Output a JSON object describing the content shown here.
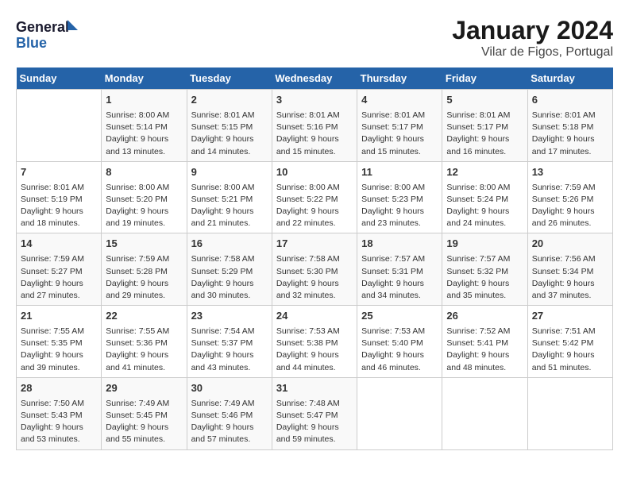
{
  "header": {
    "logo_line1": "General",
    "logo_line2": "Blue",
    "title": "January 2024",
    "subtitle": "Vilar de Figos, Portugal"
  },
  "days_of_week": [
    "Sunday",
    "Monday",
    "Tuesday",
    "Wednesday",
    "Thursday",
    "Friday",
    "Saturday"
  ],
  "weeks": [
    [
      {
        "day": "",
        "info": ""
      },
      {
        "day": "1",
        "info": "Sunrise: 8:00 AM\nSunset: 5:14 PM\nDaylight: 9 hours\nand 13 minutes."
      },
      {
        "day": "2",
        "info": "Sunrise: 8:01 AM\nSunset: 5:15 PM\nDaylight: 9 hours\nand 14 minutes."
      },
      {
        "day": "3",
        "info": "Sunrise: 8:01 AM\nSunset: 5:16 PM\nDaylight: 9 hours\nand 15 minutes."
      },
      {
        "day": "4",
        "info": "Sunrise: 8:01 AM\nSunset: 5:17 PM\nDaylight: 9 hours\nand 15 minutes."
      },
      {
        "day": "5",
        "info": "Sunrise: 8:01 AM\nSunset: 5:17 PM\nDaylight: 9 hours\nand 16 minutes."
      },
      {
        "day": "6",
        "info": "Sunrise: 8:01 AM\nSunset: 5:18 PM\nDaylight: 9 hours\nand 17 minutes."
      }
    ],
    [
      {
        "day": "7",
        "info": "Sunrise: 8:01 AM\nSunset: 5:19 PM\nDaylight: 9 hours\nand 18 minutes."
      },
      {
        "day": "8",
        "info": "Sunrise: 8:00 AM\nSunset: 5:20 PM\nDaylight: 9 hours\nand 19 minutes."
      },
      {
        "day": "9",
        "info": "Sunrise: 8:00 AM\nSunset: 5:21 PM\nDaylight: 9 hours\nand 21 minutes."
      },
      {
        "day": "10",
        "info": "Sunrise: 8:00 AM\nSunset: 5:22 PM\nDaylight: 9 hours\nand 22 minutes."
      },
      {
        "day": "11",
        "info": "Sunrise: 8:00 AM\nSunset: 5:23 PM\nDaylight: 9 hours\nand 23 minutes."
      },
      {
        "day": "12",
        "info": "Sunrise: 8:00 AM\nSunset: 5:24 PM\nDaylight: 9 hours\nand 24 minutes."
      },
      {
        "day": "13",
        "info": "Sunrise: 7:59 AM\nSunset: 5:26 PM\nDaylight: 9 hours\nand 26 minutes."
      }
    ],
    [
      {
        "day": "14",
        "info": "Sunrise: 7:59 AM\nSunset: 5:27 PM\nDaylight: 9 hours\nand 27 minutes."
      },
      {
        "day": "15",
        "info": "Sunrise: 7:59 AM\nSunset: 5:28 PM\nDaylight: 9 hours\nand 29 minutes."
      },
      {
        "day": "16",
        "info": "Sunrise: 7:58 AM\nSunset: 5:29 PM\nDaylight: 9 hours\nand 30 minutes."
      },
      {
        "day": "17",
        "info": "Sunrise: 7:58 AM\nSunset: 5:30 PM\nDaylight: 9 hours\nand 32 minutes."
      },
      {
        "day": "18",
        "info": "Sunrise: 7:57 AM\nSunset: 5:31 PM\nDaylight: 9 hours\nand 34 minutes."
      },
      {
        "day": "19",
        "info": "Sunrise: 7:57 AM\nSunset: 5:32 PM\nDaylight: 9 hours\nand 35 minutes."
      },
      {
        "day": "20",
        "info": "Sunrise: 7:56 AM\nSunset: 5:34 PM\nDaylight: 9 hours\nand 37 minutes."
      }
    ],
    [
      {
        "day": "21",
        "info": "Sunrise: 7:55 AM\nSunset: 5:35 PM\nDaylight: 9 hours\nand 39 minutes."
      },
      {
        "day": "22",
        "info": "Sunrise: 7:55 AM\nSunset: 5:36 PM\nDaylight: 9 hours\nand 41 minutes."
      },
      {
        "day": "23",
        "info": "Sunrise: 7:54 AM\nSunset: 5:37 PM\nDaylight: 9 hours\nand 43 minutes."
      },
      {
        "day": "24",
        "info": "Sunrise: 7:53 AM\nSunset: 5:38 PM\nDaylight: 9 hours\nand 44 minutes."
      },
      {
        "day": "25",
        "info": "Sunrise: 7:53 AM\nSunset: 5:40 PM\nDaylight: 9 hours\nand 46 minutes."
      },
      {
        "day": "26",
        "info": "Sunrise: 7:52 AM\nSunset: 5:41 PM\nDaylight: 9 hours\nand 48 minutes."
      },
      {
        "day": "27",
        "info": "Sunrise: 7:51 AM\nSunset: 5:42 PM\nDaylight: 9 hours\nand 51 minutes."
      }
    ],
    [
      {
        "day": "28",
        "info": "Sunrise: 7:50 AM\nSunset: 5:43 PM\nDaylight: 9 hours\nand 53 minutes."
      },
      {
        "day": "29",
        "info": "Sunrise: 7:49 AM\nSunset: 5:45 PM\nDaylight: 9 hours\nand 55 minutes."
      },
      {
        "day": "30",
        "info": "Sunrise: 7:49 AM\nSunset: 5:46 PM\nDaylight: 9 hours\nand 57 minutes."
      },
      {
        "day": "31",
        "info": "Sunrise: 7:48 AM\nSunset: 5:47 PM\nDaylight: 9 hours\nand 59 minutes."
      },
      {
        "day": "",
        "info": ""
      },
      {
        "day": "",
        "info": ""
      },
      {
        "day": "",
        "info": ""
      }
    ]
  ]
}
